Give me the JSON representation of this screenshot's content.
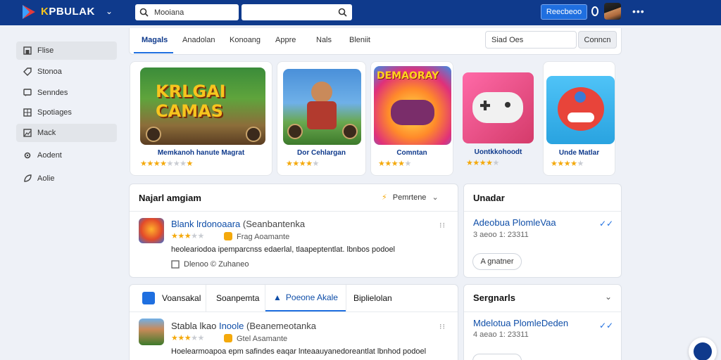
{
  "header": {
    "brand_prefix": "K",
    "brand_name": "PBULAK",
    "search_placeholder": "Mooiana",
    "action_button": "Reecbeoo"
  },
  "sidebar": {
    "items": [
      {
        "label": "Flise",
        "icon": "home-icon",
        "active": true
      },
      {
        "label": "Stonoa",
        "icon": "tag-icon",
        "active": false
      },
      {
        "label": "Senndes",
        "icon": "chat-icon",
        "active": false
      },
      {
        "label": "Spotiages",
        "icon": "grid-icon",
        "active": false
      },
      {
        "label": "Mack",
        "icon": "image-icon",
        "active": true
      },
      {
        "label": "Aodent",
        "icon": "gear-icon",
        "active": false
      },
      {
        "label": "Aolie",
        "icon": "leaf-icon",
        "active": false
      }
    ]
  },
  "tabs": {
    "items": [
      "Magals",
      "Anadolan",
      "Konoang",
      "Appre",
      "Nals",
      "Bleniit"
    ],
    "filter_placeholder": "Siad Oes",
    "filter_button": "Conncn"
  },
  "games": [
    {
      "title": "Memkanoh hanute Magrat",
      "art_text": "KRLGAI CAMAS",
      "stars": 4
    },
    {
      "title": "Dor Cehlargan",
      "stars": 4
    },
    {
      "title": "Comntan",
      "art_text": "DEMAORAY",
      "stars": 4
    },
    {
      "title": "Uontkkohoodt",
      "stars": 4
    },
    {
      "title": "Unde Matlar",
      "stars": 4
    }
  ],
  "featured": {
    "title": "Najarl amgiam",
    "sort_label": "Pemrtene",
    "item": {
      "name": "Blank lrdonoaara",
      "name_suffix": "(Seanbantenka",
      "meta": "Frag Aoamante",
      "desc": "heoleariodoa ipemparcnss edaerlal, tlaapeptentlat. lbnbos podoel",
      "footer": "Dlenoo © Zuhaneo"
    }
  },
  "updates": {
    "title": "Unadar",
    "item_title": "Adeobua PlomleVaa",
    "item_sub": "3 aeoo 1: 23311",
    "button": "A gnatner"
  },
  "bottom_tabs": {
    "items": [
      "Voansakal",
      "Soanpemta",
      "Poeone Akale",
      "Biplielolan"
    ]
  },
  "bottom_item": {
    "name": "Stabla lkao",
    "name_blue": "Inoole",
    "name_suffix": "(Beanemeotanka",
    "meta": "Gtel Asamante",
    "desc": "Hoelearmoapoa epm safindes eaqar lnteaauyanedoreantlat lbnhod podoel"
  },
  "segments": {
    "title": "Sergnarls",
    "item_title": "Mdelotua PlomleDeden",
    "item_sub": "4 aeao 1: 23311"
  },
  "colors": {
    "brand": "#0f3a8c",
    "accent": "#1f6fe0",
    "star": "#f4a90c"
  }
}
